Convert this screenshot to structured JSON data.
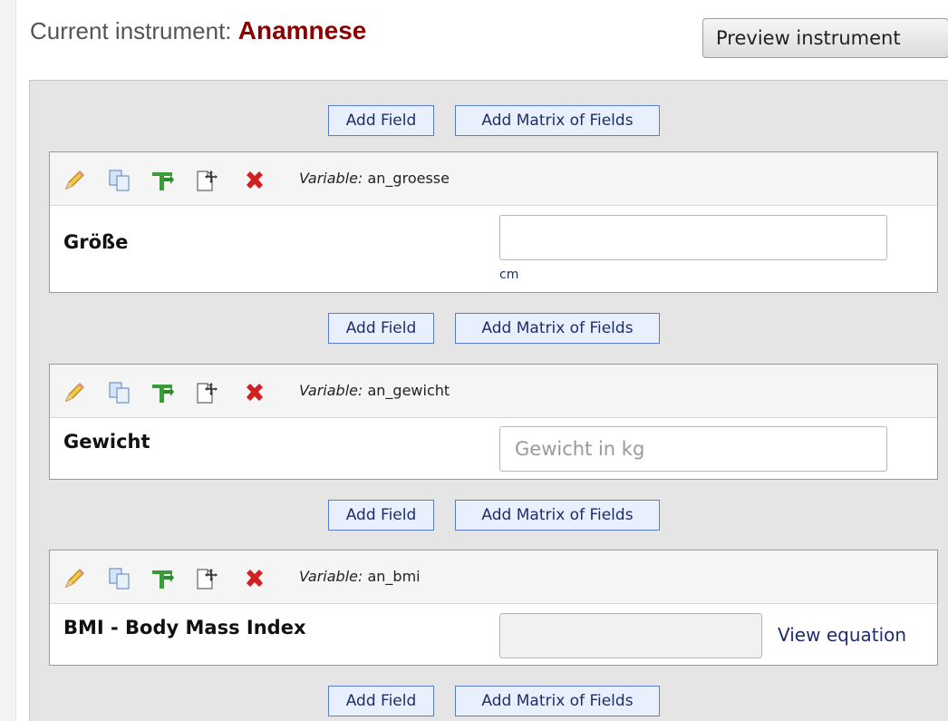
{
  "header": {
    "prefix": "Current instrument:",
    "instrument_name": "Anamnese",
    "preview_button": "Preview instrument"
  },
  "add_field_label": "Add Field",
  "add_matrix_label": "Add Matrix of Fields",
  "variable_prefix": "Variable:",
  "fields": [
    {
      "variable": "an_groesse",
      "label": "Größe",
      "placeholder": "",
      "unit": "cm"
    },
    {
      "variable": "an_gewicht",
      "label": "Gewicht",
      "placeholder": "Gewicht in kg"
    },
    {
      "variable": "an_bmi",
      "label": "BMI - Body Mass Index",
      "link": "View equation"
    }
  ]
}
